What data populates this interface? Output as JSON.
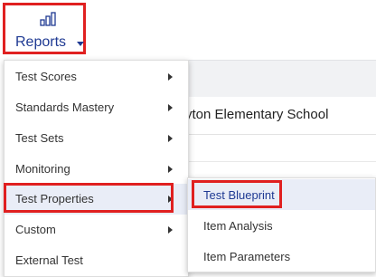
{
  "background": {
    "school_name": "yton Elementary School"
  },
  "reports_button": {
    "label": "Reports",
    "icon": "bar-chart-icon",
    "caret_icon": "caret-down-icon"
  },
  "menu": {
    "items": [
      {
        "label": "Test Scores",
        "has_submenu": true
      },
      {
        "label": "Standards Mastery",
        "has_submenu": true
      },
      {
        "label": "Test Sets",
        "has_submenu": true
      },
      {
        "label": "Monitoring",
        "has_submenu": true
      },
      {
        "label": "Test Properties",
        "has_submenu": true,
        "active": true
      },
      {
        "label": "Custom",
        "has_submenu": true
      },
      {
        "label": "External Test",
        "has_submenu": false
      }
    ]
  },
  "submenu": {
    "items": [
      {
        "label": "Test Blueprint",
        "active": true
      },
      {
        "label": "Item Analysis"
      },
      {
        "label": "Item Parameters"
      }
    ]
  },
  "colors": {
    "accent": "#1f3a93",
    "highlight_border": "#e02020",
    "active_bg": "#e9edf7"
  }
}
